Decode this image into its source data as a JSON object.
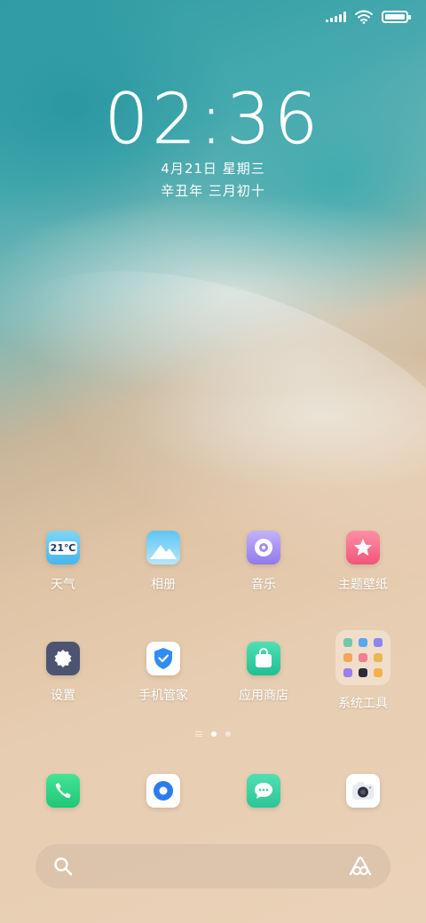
{
  "status_bar": {
    "signal_icon": "cellular-signal-icon",
    "wifi_icon": "wifi-icon",
    "battery_icon": "battery-icon",
    "battery_level": 1.0
  },
  "lockscreen": {
    "time": "02:36",
    "date": "4月21日 星期三",
    "lunar_date": "辛丑年 三月初十"
  },
  "apps": [
    {
      "label": "天气",
      "icon": "weather-icon",
      "icon_text": "21℃",
      "color": "#5bc3f0"
    },
    {
      "label": "相册",
      "icon": "gallery-icon",
      "color": "#5cc0f2"
    },
    {
      "label": "音乐",
      "icon": "music-icon",
      "color": "#a98df0"
    },
    {
      "label": "主题壁纸",
      "icon": "themes-icon",
      "color": "#f76e8a"
    },
    {
      "label": "设置",
      "icon": "settings-icon",
      "color": "#4d5472"
    },
    {
      "label": "手机管家",
      "icon": "phone-manager-icon",
      "color": "#ffffff"
    },
    {
      "label": "应用商店",
      "icon": "app-store-icon",
      "color": "#3cd0a6"
    },
    {
      "label": "系统工具",
      "icon": "folder-icon",
      "color": "#f4e6d7"
    }
  ],
  "folder_items": [
    "#6fc9a9",
    "#5aa7f0",
    "#8a86f0",
    "#f2a65a",
    "#f07f8f",
    "#e9b850",
    "#9a7ff0",
    "#2b2b3a",
    "#f5b04c"
  ],
  "page_indicator": {
    "pages": 2,
    "current": 1
  },
  "dock": [
    {
      "icon": "phone-icon",
      "color": "#2fd685"
    },
    {
      "icon": "browser-icon",
      "color": "#2c7cf0"
    },
    {
      "icon": "messages-icon",
      "color": "#3ed1a0"
    },
    {
      "icon": "camera-icon",
      "color": "#ffffff"
    }
  ],
  "search": {
    "search_icon": "search-icon",
    "assistant_icon": "assistant-icon"
  }
}
